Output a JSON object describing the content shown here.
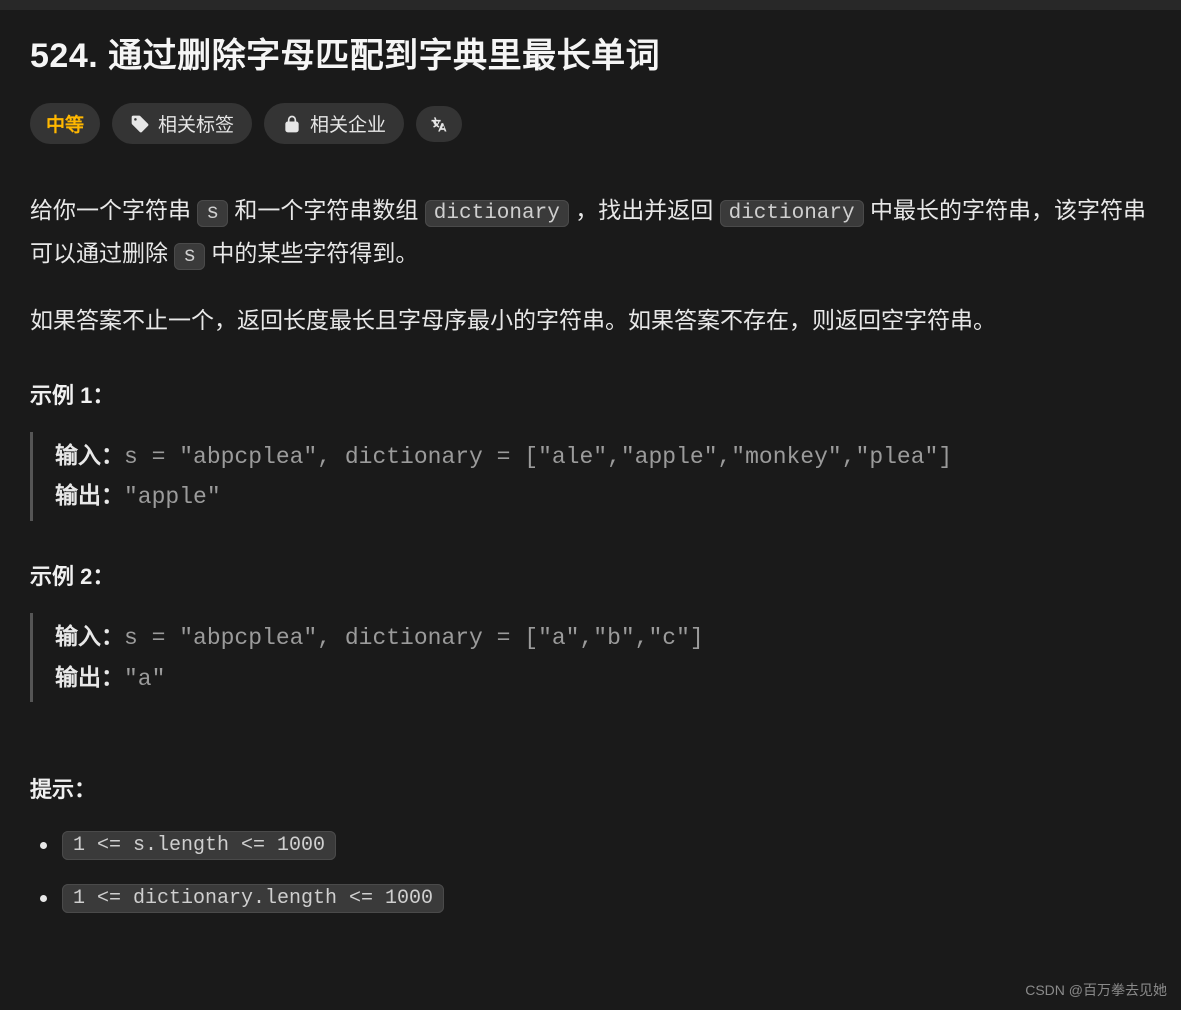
{
  "problem": {
    "title": "524. 通过删除字母匹配到字典里最长单词",
    "difficulty": "中等",
    "chips": {
      "tags": "相关标签",
      "companies": "相关企业"
    },
    "description": {
      "p1_a": "给你一个字符串 ",
      "p1_code1": "s",
      "p1_b": " 和一个字符串数组 ",
      "p1_code2": "dictionary",
      "p1_c": " ，找出并返回 ",
      "p1_code3": "dictionary",
      "p1_d": " 中最长的字符串，该字符串可以通过删除 ",
      "p1_code4": "s",
      "p1_e": " 中的某些字符得到。",
      "p2": "如果答案不止一个，返回长度最长且字母序最小的字符串。如果答案不存在，则返回空字符串。"
    },
    "examples": [
      {
        "heading": "示例 1：",
        "input_label": "输入：",
        "input_value": "s = \"abpcplea\", dictionary = [\"ale\",\"apple\",\"monkey\",\"plea\"]",
        "output_label": "输出：",
        "output_value": "\"apple\""
      },
      {
        "heading": "示例 2：",
        "input_label": "输入：",
        "input_value": "s = \"abpcplea\", dictionary = [\"a\",\"b\",\"c\"]",
        "output_label": "输出：",
        "output_value": "\"a\""
      }
    ],
    "hints_heading": "提示：",
    "constraints": [
      "1 <= s.length <= 1000",
      "1 <= dictionary.length <= 1000"
    ]
  },
  "watermark": "CSDN @百万拳去见她"
}
